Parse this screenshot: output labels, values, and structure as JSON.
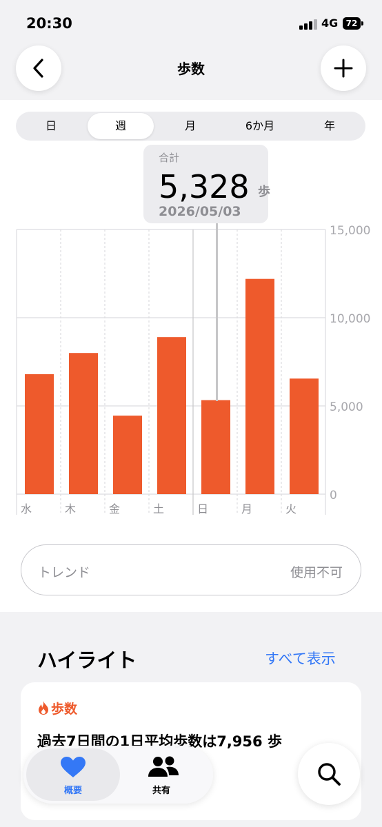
{
  "status_bar": {
    "time": "20:30",
    "network": "4G",
    "battery": "72"
  },
  "header": {
    "title": "歩数"
  },
  "segments": [
    {
      "label": "日",
      "active": false
    },
    {
      "label": "週",
      "active": true
    },
    {
      "label": "月",
      "active": false
    },
    {
      "label": "6か月",
      "active": false
    },
    {
      "label": "年",
      "active": false
    }
  ],
  "tooltip": {
    "label": "合計",
    "value": "5,328",
    "unit": "歩",
    "date": "2026/05/03"
  },
  "chart_data": {
    "type": "bar",
    "categories": [
      "水",
      "木",
      "金",
      "土",
      "日",
      "月",
      "火"
    ],
    "values": [
      6800,
      8000,
      4450,
      8900,
      5328,
      12200,
      6550
    ],
    "ylim": [
      0,
      15000
    ],
    "yticks": [
      "0",
      "5,000",
      "10,000",
      "15,000"
    ],
    "ytick_values": [
      0,
      5000,
      10000,
      15000
    ],
    "grid": true,
    "selected_index": 4,
    "bar_color": "#ee5a2c"
  },
  "trend": {
    "label": "トレンド",
    "value": "使用不可"
  },
  "highlights": {
    "title": "ハイライト",
    "show_all": "すべて表示",
    "card": {
      "category": "歩数",
      "text": "過去7日間の1日平均歩数は7,956 歩"
    }
  },
  "tabbar": {
    "tabs": [
      {
        "label": "概要",
        "active": true
      },
      {
        "label": "共有",
        "active": false
      }
    ]
  },
  "colors": {
    "accent": "#ee5a2c",
    "link": "#3478f6",
    "active_tab": "#3478f6"
  }
}
